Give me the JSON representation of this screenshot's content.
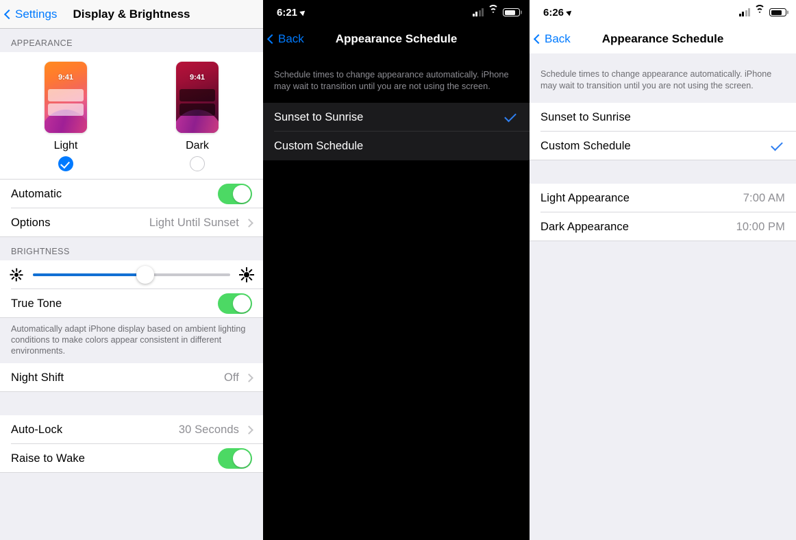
{
  "left_panel": {
    "nav": {
      "back_label": "Settings",
      "back_icon": "chevron-left-icon",
      "title": "Display & Brightness"
    },
    "appearance_section": {
      "header": "APPEARANCE",
      "choices": [
        {
          "label": "Light",
          "thumb_time": "9:41",
          "selected": true,
          "check_icon": "check-icon"
        },
        {
          "label": "Dark",
          "thumb_time": "9:41",
          "selected": false
        }
      ],
      "rows": [
        {
          "label": "Automatic",
          "control": "toggle",
          "value": "on"
        },
        {
          "label": "Options",
          "value": "Light Until Sunset",
          "control": "disclosure",
          "chevron_icon": "chevron-right-icon"
        }
      ]
    },
    "brightness_section": {
      "header": "BRIGHTNESS",
      "slider": {
        "name": "brightness-slider",
        "percent": 57,
        "low_icon": "sun-small-icon",
        "high_icon": "sun-large-icon"
      },
      "rows": [
        {
          "label": "True Tone",
          "control": "toggle",
          "value": "on"
        }
      ],
      "footnote": "Automatically adapt iPhone display based on ambient lighting conditions to make colors appear consistent in different environments."
    },
    "night_shift_section": {
      "rows": [
        {
          "label": "Night Shift",
          "value": "Off",
          "control": "disclosure",
          "chevron_icon": "chevron-right-icon"
        }
      ]
    },
    "lock_section": {
      "rows": [
        {
          "label": "Auto-Lock",
          "value": "30 Seconds",
          "control": "disclosure",
          "chevron_icon": "chevron-right-icon"
        },
        {
          "label": "Raise to Wake",
          "control": "toggle",
          "value": "on"
        }
      ]
    }
  },
  "mid_panel": {
    "status_bar": {
      "time": "6:21",
      "location_icon": "location-arrow-icon",
      "signal_icon": "cellular-bars-icon",
      "signal_bars_active": 2,
      "wifi_icon": "wifi-icon",
      "battery_icon": "battery-icon",
      "battery_percent": 75
    },
    "nav": {
      "back_label": "Back",
      "back_icon": "chevron-left-icon",
      "title": "Appearance Schedule"
    },
    "footnote": "Schedule times to change appearance automatically. iPhone may wait to transition until you are not using the screen.",
    "options": [
      {
        "label": "Sunset to Sunrise",
        "selected": true,
        "check_icon": "check-icon"
      },
      {
        "label": "Custom Schedule",
        "selected": false
      }
    ]
  },
  "right_panel": {
    "status_bar": {
      "time": "6:26",
      "location_icon": "location-arrow-icon",
      "signal_icon": "cellular-bars-icon",
      "signal_bars_active": 2,
      "wifi_icon": "wifi-icon",
      "battery_icon": "battery-icon",
      "battery_percent": 75
    },
    "nav": {
      "back_label": "Back",
      "back_icon": "chevron-left-icon",
      "title": "Appearance Schedule"
    },
    "footnote": "Schedule times to change appearance automatically. iPhone may wait to transition until you are not using the screen.",
    "options": [
      {
        "label": "Sunset to Sunrise",
        "selected": false
      },
      {
        "label": "Custom Schedule",
        "selected": true,
        "check_icon": "check-icon"
      }
    ],
    "times": [
      {
        "label": "Light Appearance",
        "value": "7:00 AM"
      },
      {
        "label": "Dark Appearance",
        "value": "10:00 PM"
      }
    ]
  },
  "colors": {
    "accent_blue": "#007aff",
    "check_blue": "#2f7ff0",
    "toggle_green": "#4cd964",
    "slider_blue": "#1170d4",
    "group_bg_light": "#efeff4",
    "row_bg_light": "#ffffff",
    "row_bg_dark": "#1b1b1d",
    "panel_bg_dark": "#000000",
    "secondary_text": "#8e8e93"
  }
}
